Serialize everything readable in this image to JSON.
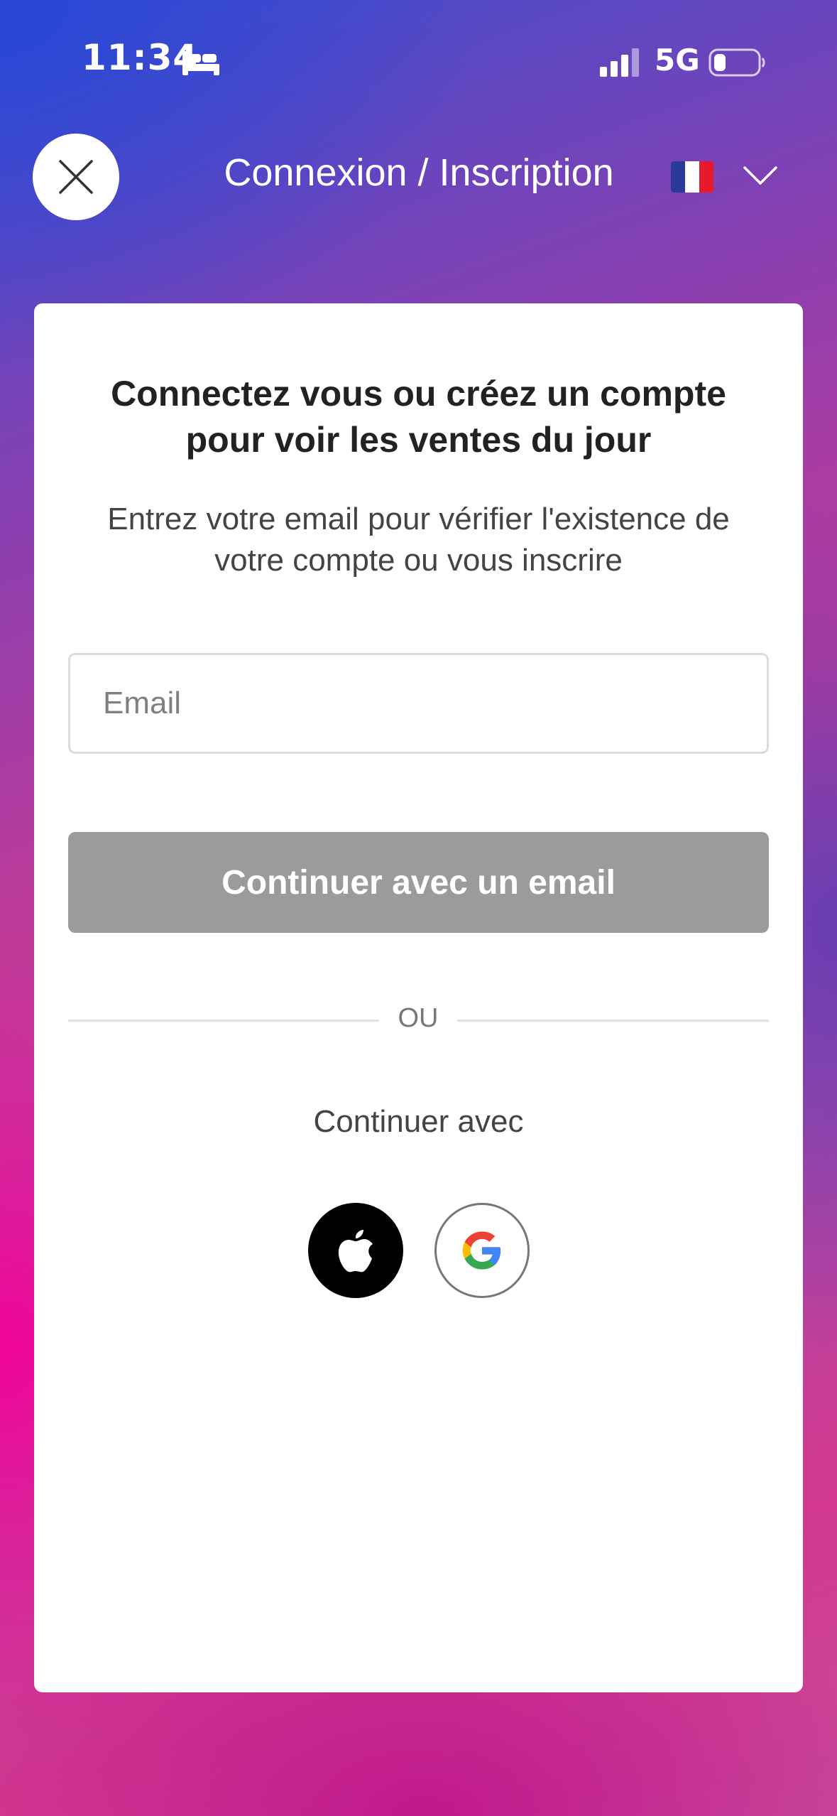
{
  "status_bar": {
    "time": "11:34",
    "network": "5G",
    "icons": [
      "sleep-focus-icon",
      "signal-icon",
      "battery-icon"
    ]
  },
  "header": {
    "title": "Connexion / Inscription",
    "close_icon": "close-icon",
    "language": {
      "flag": "france-flag-icon",
      "flag_colors": [
        "#2b3a9a",
        "#ffffff",
        "#e8192c"
      ]
    }
  },
  "card": {
    "heading": "Connectez vous ou créez un compte pour voir les ventes du jour",
    "subheading": "Entrez votre email pour vérifier l'existence de votre compte ou vous inscrire",
    "email_field": {
      "placeholder": "Email",
      "value": ""
    },
    "continue_button": "Continuer avec un email",
    "divider_label": "OU",
    "continue_with_label": "Continuer avec",
    "social": [
      {
        "name": "apple",
        "icon": "apple-icon"
      },
      {
        "name": "google",
        "icon": "google-icon"
      }
    ]
  },
  "colors": {
    "button_disabled": "#9b9b9c",
    "card_background": "#ffffff",
    "heading_text": "#222222"
  }
}
